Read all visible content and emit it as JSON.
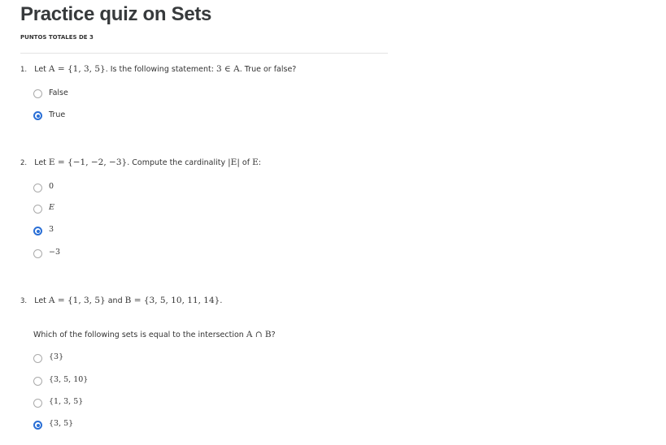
{
  "title": "Practice quiz on Sets",
  "points": "PUNTOS TOTALES DE 3",
  "colors": {
    "accent": "#2a6fd6"
  },
  "q1": {
    "num": "1.",
    "s1": "Let ",
    "m1": "A = {1, 3, 5}",
    "s2": ". Is the following statement: ",
    "m2": "3 ∈ A",
    "s3": ". True or false?",
    "options": [
      {
        "label": "False",
        "selected": false
      },
      {
        "label": "True",
        "selected": true
      }
    ]
  },
  "q2": {
    "num": "2.",
    "s1": "Let ",
    "m1": "E = {−1, −2, −3}",
    "s2": ". Compute the cardinality ",
    "m2": "|E|",
    "s3": " of ",
    "m3": "E",
    "s4": ":",
    "options": [
      {
        "label": "0",
        "selected": false
      },
      {
        "label": "E",
        "selected": false
      },
      {
        "label": "3",
        "selected": true
      },
      {
        "label": "−3",
        "selected": false
      }
    ]
  },
  "q3": {
    "num": "3.",
    "s1": "Let ",
    "m1": "A = {1, 3, 5}",
    "s2": " and ",
    "m2": "B = {3, 5, 10, 11, 14}",
    "s3": ".",
    "p2": "Which of the following sets is equal to the intersection ",
    "m3": "A ∩ B",
    "s4": "?",
    "options": [
      {
        "label": "{3}",
        "selected": false
      },
      {
        "label": "{3, 5, 10}",
        "selected": false
      },
      {
        "label": "{1, 3, 5}",
        "selected": false
      },
      {
        "label": "{3, 5}",
        "selected": true
      }
    ]
  }
}
